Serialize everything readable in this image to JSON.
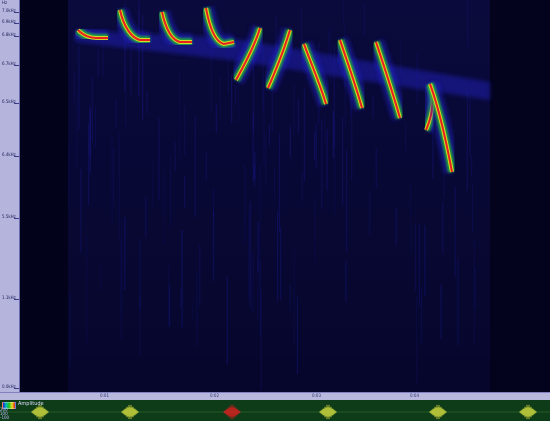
{
  "frequency_axis": {
    "unit": "Hz",
    "ticks": [
      "7.0kHz",
      "6.9kHz",
      "6.8kHz",
      "6.7kHz",
      "6.5kHz",
      "6.4kHz",
      "5.5kHz",
      "1.1kHz",
      "0.0kHz"
    ]
  },
  "time_ruler": {
    "labels": [
      "0:01",
      "0:02",
      "0:03",
      "0:04"
    ]
  },
  "waveform": {
    "label": "Amplitude",
    "values": [
      "200",
      "100",
      "-100"
    ]
  },
  "colors": {
    "background": "#05052a",
    "low": "#2222c8",
    "mid": "#22c822",
    "high": "#e6e622",
    "peak": "#e82020",
    "waveform_bg": "#0e3b18",
    "waveform": "#d8e040",
    "waveform_highlight": "#e02020"
  }
}
